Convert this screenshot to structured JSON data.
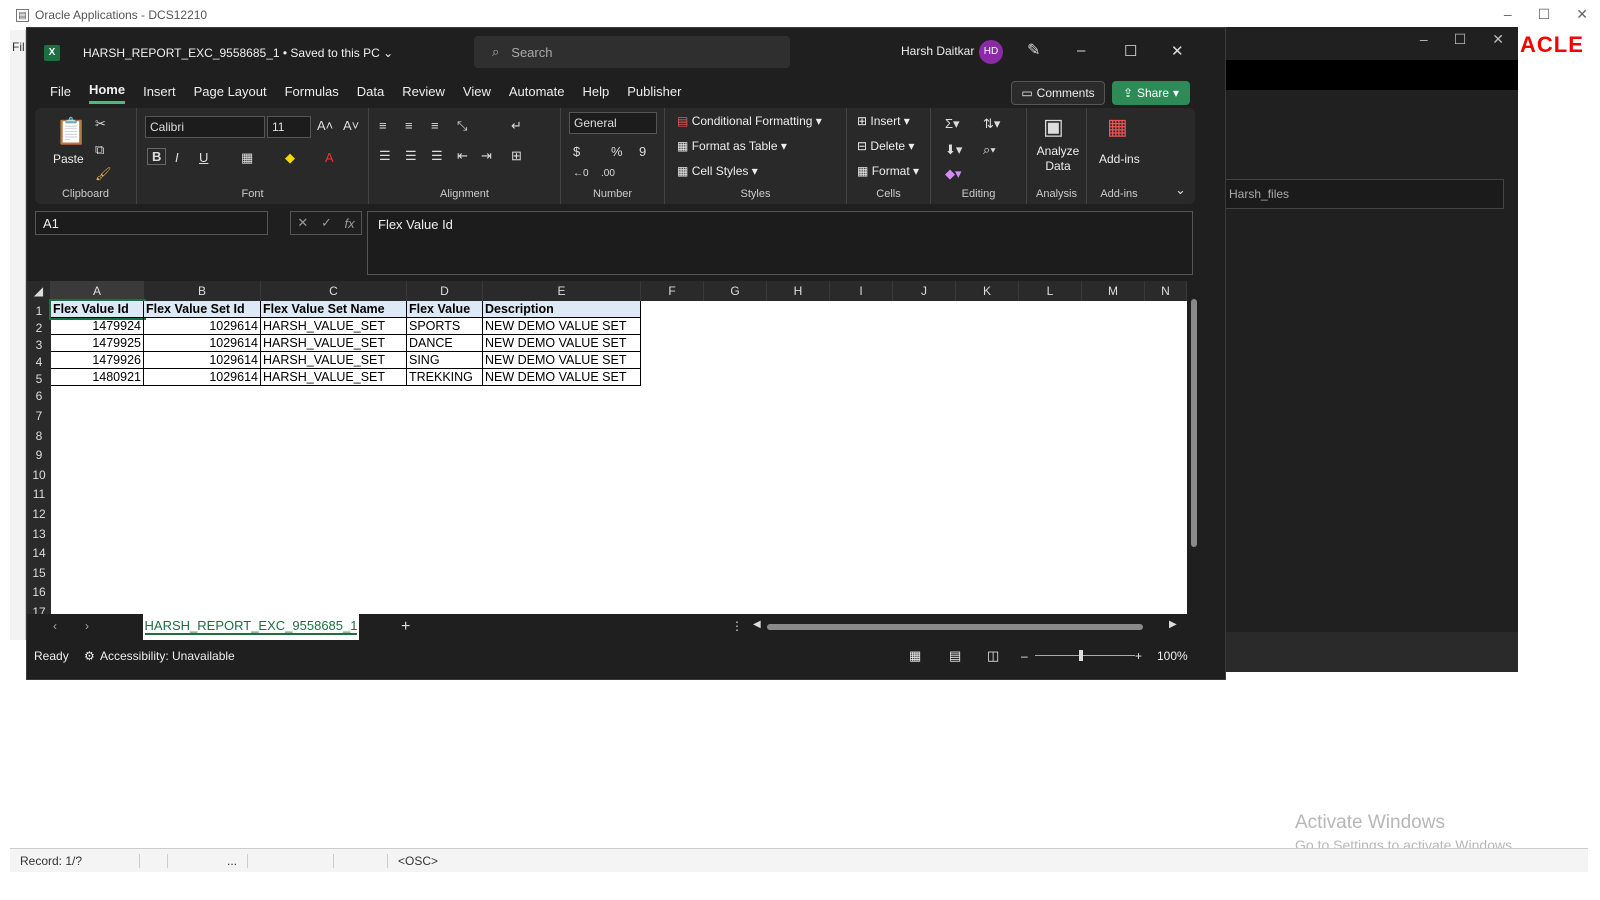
{
  "oracle": {
    "title": "Oracle Applications - DCS12210",
    "left_menu": "Fil",
    "logo": "ACLE",
    "status": {
      "record": "Record: 1/?",
      "dots": "...",
      "osc": "<OSC>"
    },
    "activate": {
      "line1": "Activate Windows",
      "line2": "Go to Settings to activate Windows."
    }
  },
  "bgwin": {
    "search": "ch Harsh_files",
    "partial": "n"
  },
  "excel": {
    "doc_title": "HARSH_REPORT_EXC_9558685_1 • Saved to this PC ⌄",
    "search_placeholder": "Search",
    "user": "Harsh Daitkar",
    "avatar": "HD",
    "menu": [
      "File",
      "Home",
      "Insert",
      "Page Layout",
      "Formulas",
      "Data",
      "Review",
      "View",
      "Automate",
      "Help",
      "Publisher"
    ],
    "comments": "Comments",
    "share": "Share",
    "ribbon": {
      "paste": "Paste",
      "clipboard": "Clipboard",
      "font_name": "Calibri",
      "font_size": "11",
      "font": "Font",
      "alignment": "Alignment",
      "number_format": "General",
      "number": "Number",
      "cond_format": "Conditional Formatting",
      "format_table": "Format as Table",
      "cell_styles": "Cell Styles",
      "styles": "Styles",
      "insert": "Insert",
      "delete": "Delete",
      "format": "Format",
      "cells": "Cells",
      "editing": "Editing",
      "analyze": "Analyze Data",
      "analysis": "Analysis",
      "addins": "Add-ins",
      "addins_group": "Add-ins"
    },
    "name_box": "A1",
    "formula": "Flex Value Id",
    "columns": [
      "A",
      "B",
      "C",
      "D",
      "E",
      "F",
      "G",
      "H",
      "I",
      "J",
      "K",
      "L",
      "M",
      "N"
    ],
    "rows": [
      "1",
      "2",
      "3",
      "4",
      "5",
      "6",
      "7",
      "8",
      "9",
      "10",
      "11",
      "12",
      "13",
      "14",
      "15",
      "16",
      "17"
    ],
    "table": {
      "headers": [
        "Flex Value Id",
        "Flex Value Set Id",
        "Flex Value Set Name",
        "Flex Value",
        "Description"
      ],
      "rows": [
        [
          "1479924",
          "1029614",
          "HARSH_VALUE_SET",
          "SPORTS",
          "NEW DEMO VALUE SET"
        ],
        [
          "1479925",
          "1029614",
          "HARSH_VALUE_SET",
          "DANCE",
          "NEW DEMO VALUE SET"
        ],
        [
          "1479926",
          "1029614",
          "HARSH_VALUE_SET",
          "SING",
          "NEW DEMO VALUE SET"
        ],
        [
          "1480921",
          "1029614",
          "HARSH_VALUE_SET",
          "TREKKING",
          "NEW DEMO VALUE SET"
        ]
      ]
    },
    "sheet_tab": "HARSH_REPORT_EXC_9558685_1",
    "status": {
      "ready": "Ready",
      "accessibility": "Accessibility: Unavailable",
      "zoom": "100%"
    }
  }
}
